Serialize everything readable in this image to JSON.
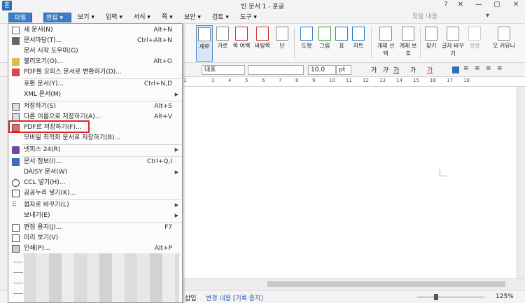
{
  "window": {
    "title": "빈 문서 1 - 훈글",
    "app_icon": "훈",
    "controls": [
      "?",
      "✕",
      "—",
      "▢",
      "✕"
    ]
  },
  "menubar": {
    "items": [
      "파일",
      "편집",
      "보기",
      "입력",
      "서식",
      "쪽",
      "보안",
      "검토",
      "도구"
    ],
    "search_placeholder": "찾을 내용"
  },
  "ribbon": {
    "buttons": [
      "세로",
      "가로",
      "쪽 여백",
      "바탕쪽",
      "단",
      "도형",
      "그림",
      "표",
      "차트",
      "개체 선택",
      "개체 보호",
      "찾기",
      "글자 바꾸기",
      "정렬",
      "오 커뮤니"
    ]
  },
  "formatbar": {
    "style": "대표",
    "size": "10.0",
    "unit": "pt"
  },
  "ruler": {
    "numbers": [
      "1",
      "3",
      "4",
      "5",
      "6",
      "7",
      "8",
      "9",
      "10",
      "11",
      "12",
      "13",
      "14",
      "15",
      "16",
      "17",
      "18"
    ]
  },
  "statusbar": {
    "insert": "삽입",
    "track": "변경 내용 [기록 중지]",
    "zoom": "125%"
  },
  "file_menu": {
    "items": [
      {
        "label": "새 문서(N)",
        "shortcut": "Alt+N"
      },
      {
        "label": "문서마당(T)...",
        "shortcut": "Ctrl+Alt+N"
      },
      {
        "label": "문서 시작 도우미(G)",
        "shortcut": ""
      },
      {
        "label": "불러오기(O)...",
        "shortcut": "Alt+O"
      },
      {
        "label": "PDF를 오피스 문서로 변환하기(D)...",
        "shortcut": ""
      },
      {
        "label": "호환 문서(Y)...",
        "shortcut": "Ctrl+N,D"
      },
      {
        "label": "XML 문서(M)",
        "shortcut": ""
      },
      {
        "label": "저장하기(S)",
        "shortcut": "Alt+S"
      },
      {
        "label": "다른 이름으로 저장하기(A)...",
        "shortcut": "Alt+V"
      },
      {
        "label": "PDF로 저장하기(F)...",
        "shortcut": ""
      },
      {
        "label": "모바일 최적화 문서로 저장하기(B)...",
        "shortcut": ""
      },
      {
        "label": "넷피스 24(R)",
        "shortcut": ""
      },
      {
        "label": "문서 정보(I)...",
        "shortcut": "Ctrl+Q,I"
      },
      {
        "label": "DAISY 문서(W)",
        "shortcut": ""
      },
      {
        "label": "CCL 넣기(H)...",
        "shortcut": ""
      },
      {
        "label": "공공누리 넣기(K)...",
        "shortcut": ""
      },
      {
        "label": "점자로 바꾸기(L)",
        "shortcut": ""
      },
      {
        "label": "보내기(E)",
        "shortcut": ""
      },
      {
        "label": "편집 용지(J)...",
        "shortcut": "F7"
      },
      {
        "label": "미리 보기(V)",
        "shortcut": ""
      },
      {
        "label": "인쇄(P)...",
        "shortcut": "Alt+P"
      }
    ]
  }
}
